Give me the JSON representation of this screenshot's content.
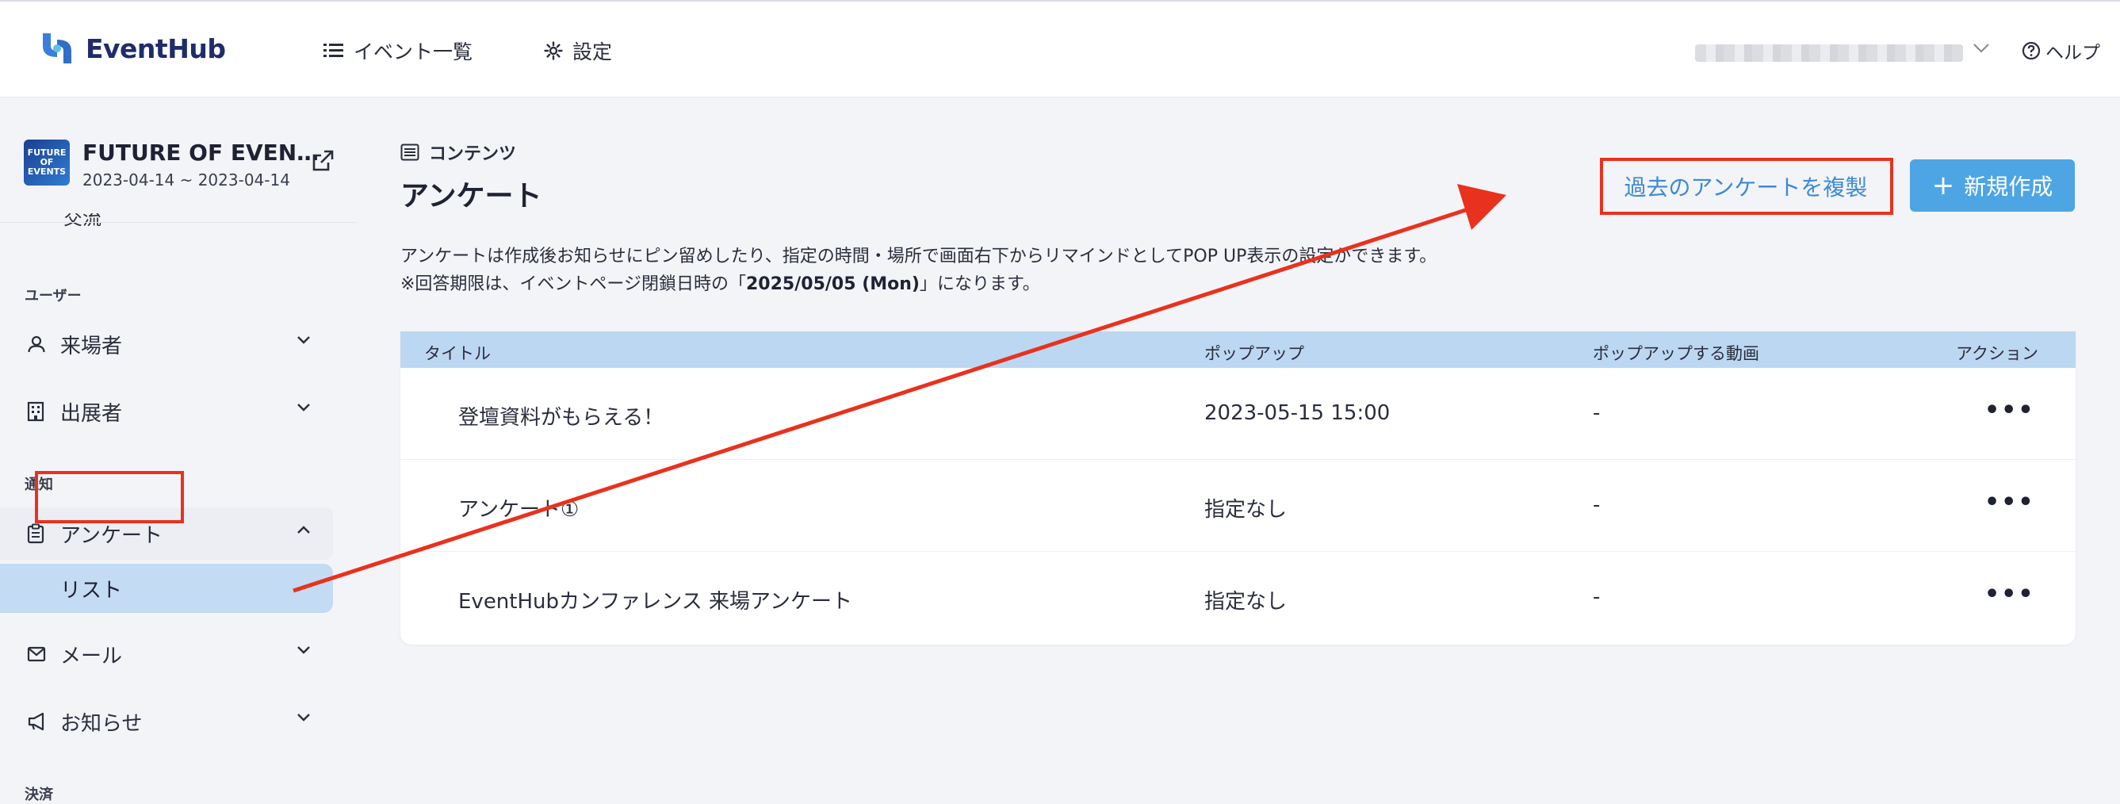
{
  "app": {
    "logo_text": "EventHub",
    "nav": [
      {
        "label": "イベント一覧",
        "icon": "list-icon"
      },
      {
        "label": "設定",
        "icon": "gear-icon"
      }
    ],
    "help_label": "ヘルプ"
  },
  "sidebar": {
    "event": {
      "thumb_text": "FUTURE OF EVENTS",
      "name": "FUTURE OF EVEN…",
      "dates": "2023-04-14 ~ 2023-04-14"
    },
    "clipped_item": "交流",
    "sections": {
      "user": "ユーザー",
      "notify": "通知",
      "payment": "決済"
    },
    "items": {
      "visitors": "来場者",
      "exhibitors": "出展者",
      "survey": "アンケート",
      "survey_list": "リスト",
      "mail": "メール",
      "notice": "お知らせ"
    }
  },
  "main": {
    "breadcrumb": "コンテンツ",
    "title": "アンケート",
    "desc_line1": "アンケートは作成後お知らせにピン留めしたり、指定の時間・場所で画面右下からリマインドとしてPOP UP表示の設定ができます。",
    "desc_line2_prefix": "※回答期限は、イベントページ閉鎖日時の「",
    "desc_line2_date": "2025/05/05 (Mon)",
    "desc_line2_suffix": "」になります。",
    "copy_button": "過去のアンケートを複製",
    "new_button": "新規作成",
    "table": {
      "headers": [
        "タイトル",
        "ポップアップ",
        "ポップアップする動画",
        "アクション"
      ],
      "rows": [
        {
          "title": "登壇資料がもらえる！",
          "popup": "2023-05-15 15:00",
          "video": "-",
          "action": "•••"
        },
        {
          "title": "アンケート①",
          "popup": "指定なし",
          "video": "-",
          "action": "•••"
        },
        {
          "title": "EventHubカンファレンス 来場アンケート",
          "popup": "指定なし",
          "video": "-",
          "action": "•••"
        }
      ]
    }
  },
  "colors": {
    "accent": "#4ea5e4",
    "link": "#3d8ad6",
    "highlight": "#e8321e",
    "selected_bg": "#c3dbf3",
    "table_header_bg": "#bcd7f1"
  }
}
